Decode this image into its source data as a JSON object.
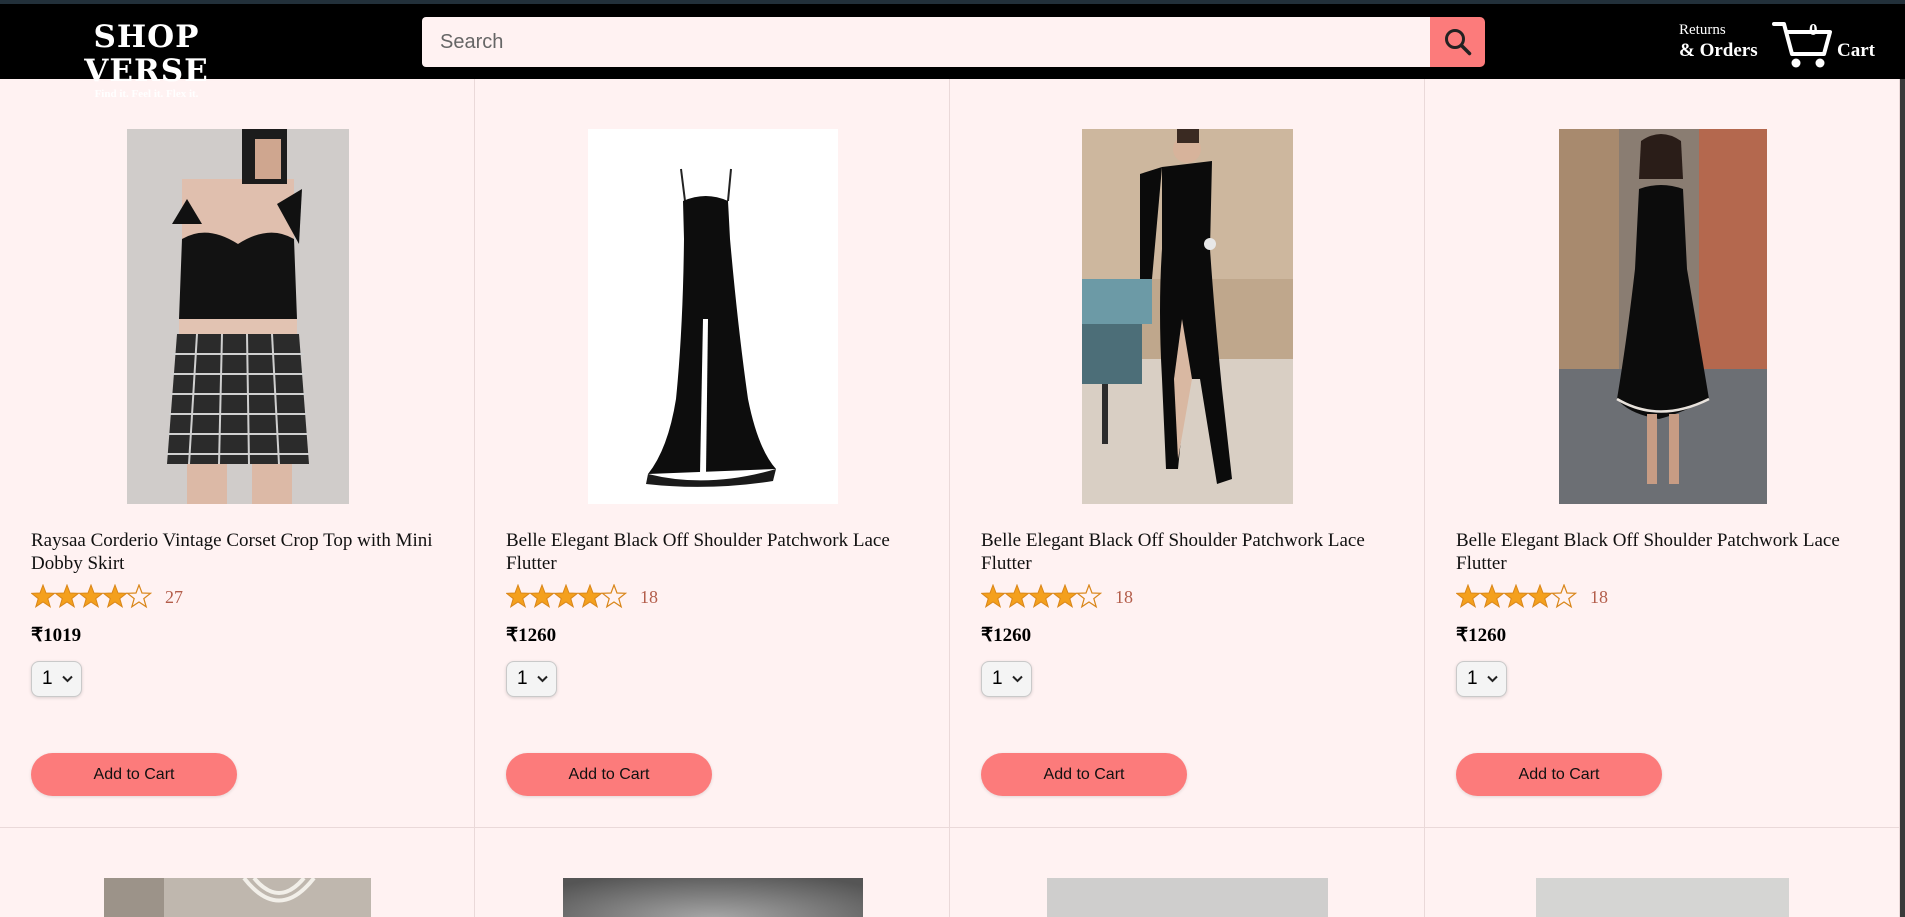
{
  "header": {
    "logo_title": "SHOP VERSE",
    "logo_tagline": "Find it. Feel it. Flex it.",
    "search_placeholder": "Search",
    "search_icon": "search-icon",
    "returns_line1": "Returns",
    "returns_line2": "& Orders",
    "cart_count": "0",
    "cart_label": "Cart",
    "cart_icon": "cart-icon"
  },
  "colors": {
    "header_bg": "#000000",
    "page_bg": "#fff2f2",
    "accent": "#fc7b7b",
    "star": "#f4a01d",
    "rating_count": "#b35d4a"
  },
  "products": [
    {
      "name": "Raysaa Corderio Vintage Corset Crop Top with Mini Dobby Skirt",
      "rating": 4.5,
      "rating_count": "27",
      "price": "₹1019",
      "quantity": "1",
      "add_label": "Add to Cart",
      "image": "corset-top-skirt-photo"
    },
    {
      "name": "Belle Elegant Black Off Shoulder Patchwork Lace Flutter",
      "rating": 4,
      "rating_count": "18",
      "price": "₹1260",
      "quantity": "1",
      "add_label": "Add to Cart",
      "image": "black-gown-photo"
    },
    {
      "name": "Belle Elegant Black Off Shoulder Patchwork Lace Flutter",
      "rating": 4,
      "rating_count": "18",
      "price": "₹1260",
      "quantity": "1",
      "add_label": "Add to Cart",
      "image": "one-shoulder-gown-photo"
    },
    {
      "name": "Belle Elegant Black Off Shoulder Patchwork Lace Flutter",
      "rating": 4,
      "rating_count": "18",
      "price": "₹1260",
      "quantity": "1",
      "add_label": "Add to Cart",
      "image": "black-slip-dress-photo"
    }
  ],
  "next_row_images": [
    "pearl-necklace-photo",
    "grey-backdrop-photo",
    "light-grey-photo",
    "light-grey-photo-2"
  ]
}
